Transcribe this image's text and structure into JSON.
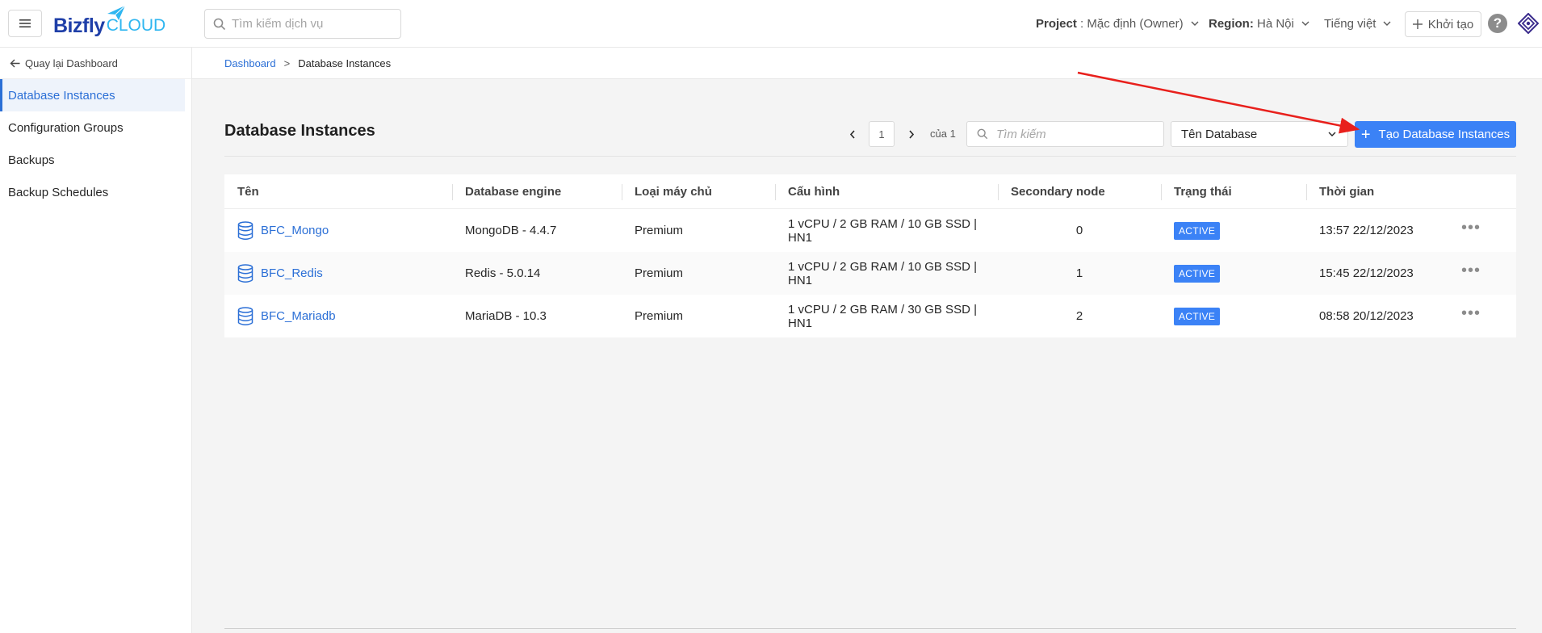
{
  "header": {
    "logo_text_1": "Bizfly",
    "logo_text_2": "CLOUD",
    "search_placeholder": "Tìm kiếm dịch vụ",
    "project_label": "Project",
    "project_value": " : Mặc định (Owner)",
    "region_label": "Region:",
    "region_value": " Hà Nội",
    "language": "Tiếng việt",
    "create_label": "Khởi tạo",
    "help_symbol": "?"
  },
  "sidebar": {
    "back_label": "Quay lại Dashboard",
    "items": [
      {
        "label": "Database Instances",
        "active": true
      },
      {
        "label": "Configuration Groups",
        "active": false
      },
      {
        "label": "Backups",
        "active": false
      },
      {
        "label": "Backup Schedules",
        "active": false
      }
    ]
  },
  "breadcrumb": {
    "root": "Dashboard",
    "separator": ">",
    "current": "Database Instances"
  },
  "main": {
    "title": "Database Instances",
    "pagination": {
      "current_page": "1",
      "of_label": "của 1"
    },
    "search_placeholder": "Tìm kiếm",
    "filter_value": "Tên Database",
    "create_button": "Tạo Database Instances"
  },
  "table": {
    "columns": [
      "Tên",
      "Database engine",
      "Loại máy chủ",
      "Cấu hình",
      "Secondary node",
      "Trạng thái",
      "Thời gian"
    ],
    "rows": [
      {
        "name": "BFC_Mongo",
        "engine": "MongoDB - 4.4.7",
        "type": "Premium",
        "config": "1 vCPU / 2 GB RAM / 10 GB SSD | HN1",
        "secondary": "0",
        "status": "ACTIVE",
        "time": "13:57 22/12/2023"
      },
      {
        "name": "BFC_Redis",
        "engine": "Redis - 5.0.14",
        "type": "Premium",
        "config": "1 vCPU / 2 GB RAM / 10 GB SSD | HN1",
        "secondary": "1",
        "status": "ACTIVE",
        "time": "15:45 22/12/2023"
      },
      {
        "name": "BFC_Mariadb",
        "engine": "MariaDB - 10.3",
        "type": "Premium",
        "config": "1 vCPU / 2 GB RAM / 30 GB SSD | HN1",
        "secondary": "2",
        "status": "ACTIVE",
        "time": "08:58 20/12/2023"
      }
    ],
    "more_symbol": "•••"
  },
  "colors": {
    "primary": "#3b82f6",
    "link": "#2b6fd6",
    "annotation_arrow": "#e8201c"
  }
}
